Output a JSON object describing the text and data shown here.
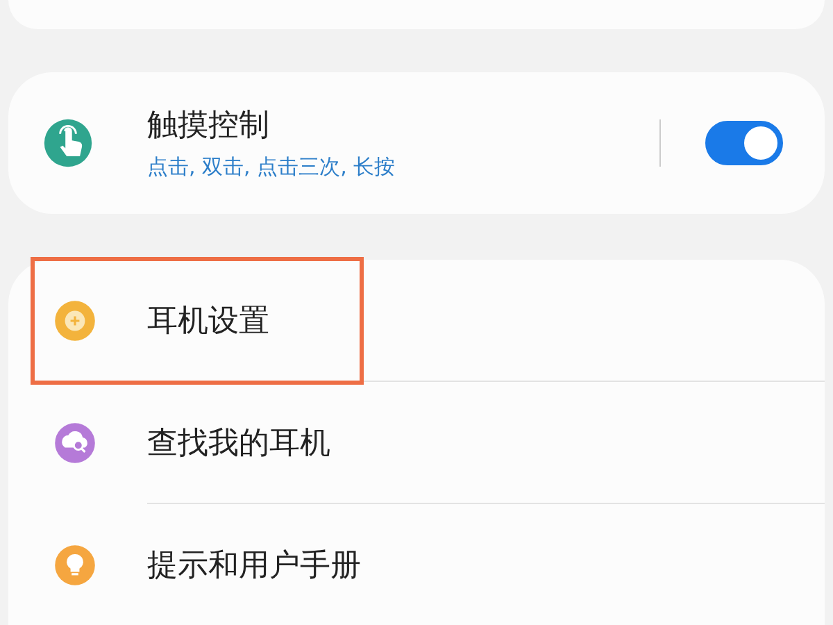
{
  "touch_control": {
    "title": "触摸控制",
    "subtitle": "点击, 双击, 点击三次, 长按",
    "on": true,
    "icon": {
      "kind": "hand",
      "color": "#2fa58e"
    }
  },
  "menu_items": [
    {
      "label": "耳机设置",
      "highlighted": true,
      "icon": {
        "kind": "gear",
        "color": "#f3b33c"
      }
    },
    {
      "label": "查找我的耳机",
      "highlighted": false,
      "icon": {
        "kind": "find",
        "color": "#b57ad8"
      }
    },
    {
      "label": "提示和用户手册",
      "highlighted": false,
      "icon": {
        "kind": "bulb",
        "color": "#f5a640"
      }
    }
  ]
}
